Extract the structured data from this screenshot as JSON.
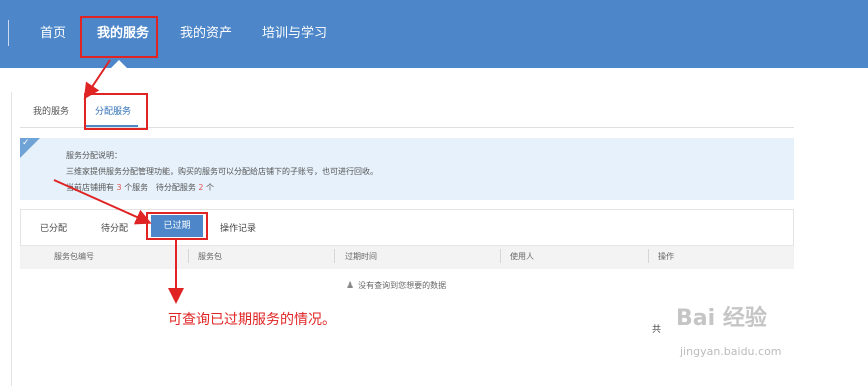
{
  "nav": {
    "items": [
      "首页",
      "我的服务",
      "我的资产",
      "培训与学习"
    ]
  },
  "subtabs": [
    "我的服务",
    "分配服务"
  ],
  "info": {
    "title": "服务分配说明：",
    "desc": "三维家提供服务分配管理功能，购买的服务可以分配给店铺下的子账号，也可进行回收。",
    "stats_prefix": "当前店铺拥有",
    "owned_count": "3",
    "owned_suffix": "个服务",
    "pending_prefix": "待分配服务",
    "pending_count": "2",
    "pending_suffix": "个"
  },
  "panel": {
    "tabs": [
      "已分配",
      "待分配",
      "已过期",
      "操作记录"
    ],
    "active_tab": "已过期",
    "columns": [
      "服务包编号",
      "服务包",
      "过期时间",
      "使用人",
      "操作"
    ],
    "empty_text": "没有查询到您想要的数据"
  },
  "annotation": "可查询已过期服务的情况。",
  "pager_text": "共",
  "watermark": "Bai 经验",
  "watermark_url": "jingyan.baidu.com",
  "colors": {
    "topbar": "#4d87c9",
    "highlight": "#e02424",
    "info_bg": "#e6f1fb"
  }
}
